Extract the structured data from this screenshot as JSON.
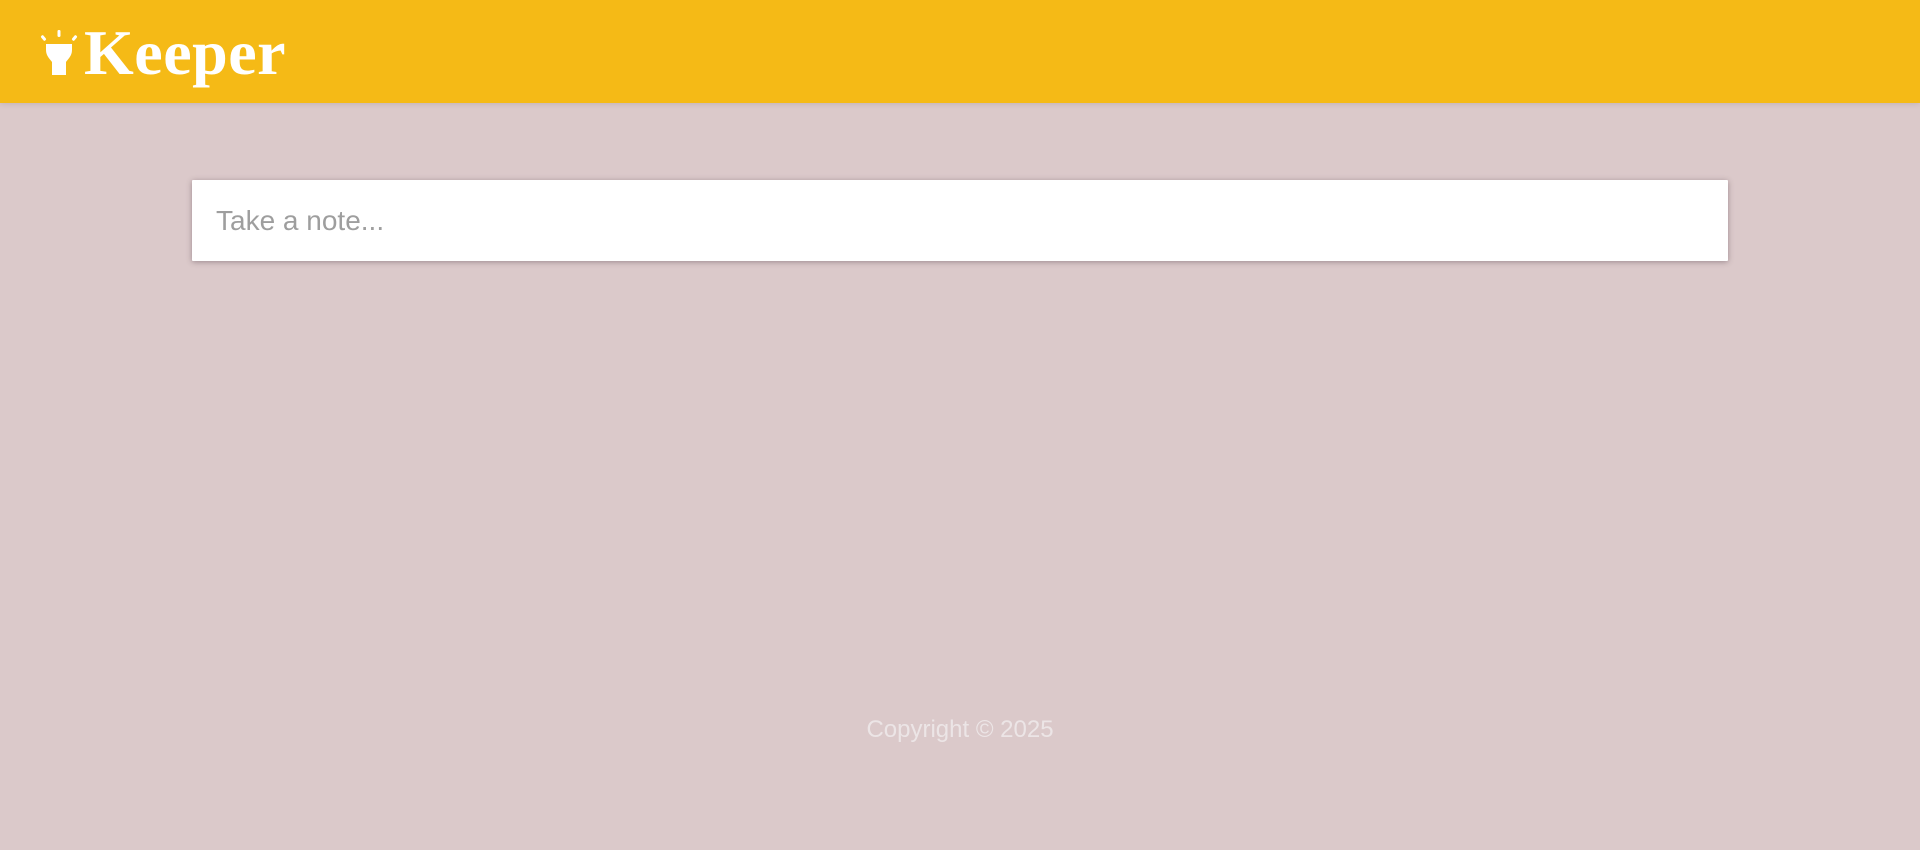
{
  "header": {
    "logo_icon": "lightbulb-icon",
    "title": "Keeper",
    "background_color": "#f5ba16"
  },
  "note_form": {
    "placeholder": "Take a note...",
    "value": ""
  },
  "footer": {
    "copyright": "Copyright © 2025"
  },
  "colors": {
    "page_background": "#dbc9ca",
    "header_text": "#ffffff"
  }
}
